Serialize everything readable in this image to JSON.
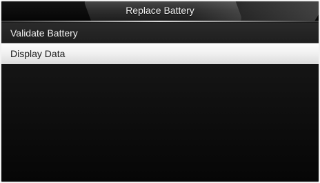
{
  "header": {
    "title": "Replace Battery"
  },
  "menu": {
    "items": [
      {
        "label": "Validate Battery",
        "selected": false
      },
      {
        "label": "Display Data",
        "selected": true
      }
    ]
  },
  "colors": {
    "background": "#000000",
    "selected_bg": "#f0f0f0",
    "text_light": "#f0f0f0",
    "text_dark": "#1a1a1a"
  }
}
